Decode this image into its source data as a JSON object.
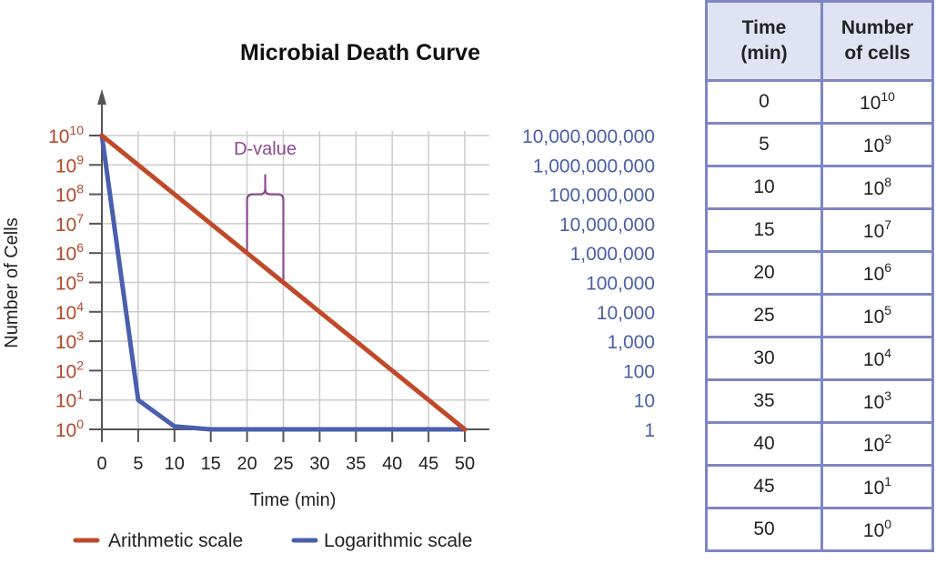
{
  "chart_data": {
    "type": "line",
    "title": "Microbial Death Curve",
    "xlabel": "Time (min)",
    "ylabel": "Number of Cells",
    "x": [
      0,
      5,
      10,
      15,
      20,
      25,
      30,
      35,
      40,
      45,
      50
    ],
    "xlim": [
      0,
      50
    ],
    "ylim_log10": [
      0,
      10
    ],
    "grid": true,
    "x_tick_labels": [
      "0",
      "5",
      "10",
      "15",
      "20",
      "25",
      "30",
      "35",
      "40",
      "45",
      "50"
    ],
    "y_tick_labels_left": [
      {
        "base": "10",
        "exp": "10"
      },
      {
        "base": "10",
        "exp": "9"
      },
      {
        "base": "10",
        "exp": "8"
      },
      {
        "base": "10",
        "exp": "7"
      },
      {
        "base": "10",
        "exp": "6"
      },
      {
        "base": "10",
        "exp": "5"
      },
      {
        "base": "10",
        "exp": "4"
      },
      {
        "base": "10",
        "exp": "3"
      },
      {
        "base": "10",
        "exp": "2"
      },
      {
        "base": "10",
        "exp": "1"
      },
      {
        "base": "10",
        "exp": "0"
      }
    ],
    "y_tick_labels_right": [
      "10,000,000,000",
      "1,000,000,000",
      "100,000,000",
      "10,000,000",
      "1,000,000",
      "100,000",
      "10,000",
      "1,000",
      "100",
      "10",
      "1"
    ],
    "series": [
      {
        "name": "Arithmetic scale",
        "color": "#bf4a2a",
        "log10_values": [
          10,
          9,
          8,
          7,
          6,
          5,
          4,
          3,
          2,
          1,
          0
        ]
      },
      {
        "name": "Logarithmic scale",
        "color": "#4a5fae",
        "log10_values": [
          10,
          1,
          0.1,
          0,
          0,
          0,
          0,
          0,
          0,
          0,
          0
        ]
      }
    ],
    "legend_position": "bottom",
    "annotations": [
      {
        "text": "D-value",
        "type": "brace",
        "x_range": [
          20,
          25
        ],
        "color": "#8c4a92"
      }
    ]
  },
  "table": {
    "headers": [
      [
        "Time",
        "(min)"
      ],
      [
        "Number",
        "of cells"
      ]
    ],
    "rows": [
      {
        "time": "0",
        "base": "10",
        "exp": "10"
      },
      {
        "time": "5",
        "base": "10",
        "exp": "9"
      },
      {
        "time": "10",
        "base": "10",
        "exp": "8"
      },
      {
        "time": "15",
        "base": "10",
        "exp": "7"
      },
      {
        "time": "20",
        "base": "10",
        "exp": "6"
      },
      {
        "time": "25",
        "base": "10",
        "exp": "5"
      },
      {
        "time": "30",
        "base": "10",
        "exp": "4"
      },
      {
        "time": "35",
        "base": "10",
        "exp": "3"
      },
      {
        "time": "40",
        "base": "10",
        "exp": "2"
      },
      {
        "time": "45",
        "base": "10",
        "exp": "1"
      },
      {
        "time": "50",
        "base": "10",
        "exp": "0"
      }
    ]
  }
}
